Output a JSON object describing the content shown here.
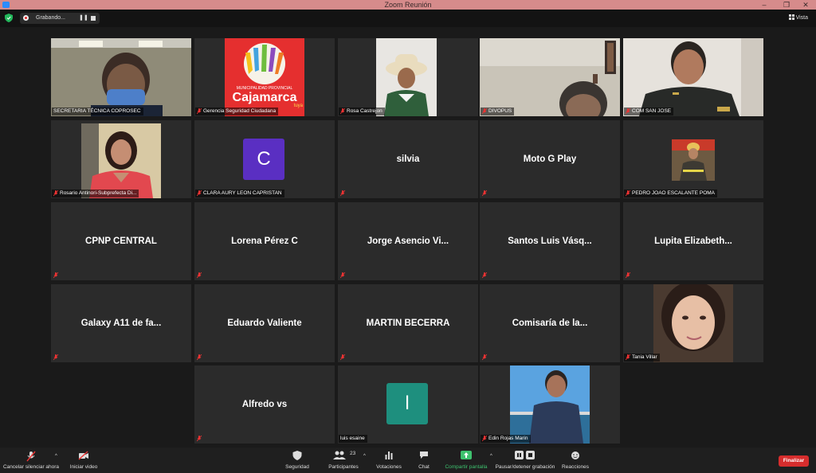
{
  "window": {
    "title": "Zoom Reunión",
    "minimize": "–",
    "maximize": "❐",
    "close": "✕"
  },
  "topbar": {
    "recording_label": "Grabando...",
    "pause_glyph": "❚❚",
    "view_label": "Vista"
  },
  "participants": [
    {
      "id": "secretaria",
      "label": "SECRETARIA TÉCNICA COPROSEC",
      "type": "video",
      "muted": false
    },
    {
      "id": "gerencia",
      "label": "Gerencia Seguridad Ciudadana",
      "type": "video",
      "muted": true,
      "logo_small": "MUNICIPALIDAD PROVINCIAL",
      "logo_big": "Cajamarca",
      "logo_tag": "tuya"
    },
    {
      "id": "rosa",
      "label": "Rosa Castrejon",
      "type": "video",
      "muted": true
    },
    {
      "id": "divopus",
      "label": "DIVOPUS",
      "type": "video",
      "muted": true,
      "active": true
    },
    {
      "id": "comsanjose",
      "label": "COM SAN JOSE",
      "type": "video",
      "muted": true
    },
    {
      "id": "rosario",
      "label": "Rosario Antinori-Subprefecta Di...",
      "type": "video",
      "muted": true
    },
    {
      "id": "clara",
      "label": "CLARA AURY LEON CAPRISTAN",
      "type": "avatar",
      "muted": true,
      "initial": "C",
      "color": "#5a2fc2"
    },
    {
      "id": "silvia",
      "name": "silvia",
      "type": "name",
      "muted": true
    },
    {
      "id": "motog",
      "name": "Moto G Play",
      "type": "name",
      "muted": true
    },
    {
      "id": "pedro",
      "label": "PEDRO JOAO ESCALANTE POMA",
      "type": "video",
      "muted": true
    },
    {
      "id": "cpnp",
      "name": "CPNP CENTRAL",
      "type": "name",
      "muted": true
    },
    {
      "id": "lorena",
      "name": "Lorena Pérez C",
      "type": "name",
      "muted": true
    },
    {
      "id": "jorge",
      "name": "Jorge Asencio Vi...",
      "type": "name",
      "muted": true
    },
    {
      "id": "santos",
      "name": "Santos Luis Vásq...",
      "type": "name",
      "muted": true
    },
    {
      "id": "lupita",
      "name": "Lupita Elizabeth...",
      "type": "name",
      "muted": true
    },
    {
      "id": "galaxy",
      "name": "Galaxy A11 de fa...",
      "type": "name",
      "muted": true
    },
    {
      "id": "eduardo",
      "name": "Eduardo Valiente",
      "type": "name",
      "muted": true
    },
    {
      "id": "martin",
      "name": "MARTIN BECERRA",
      "type": "name",
      "muted": true
    },
    {
      "id": "comisaria",
      "name": "Comisaría de la...",
      "type": "name",
      "muted": true
    },
    {
      "id": "tania",
      "label": "Tania Villar",
      "type": "video",
      "muted": true
    },
    {
      "id": "alfredo",
      "name": "Alfredo vs",
      "type": "name",
      "muted": true
    },
    {
      "id": "luis",
      "label": "luis esaine",
      "type": "avatar",
      "muted": false,
      "initial": "l",
      "color": "#1e8f7e"
    },
    {
      "id": "edin",
      "label": "Edin Rojas Marin",
      "type": "video",
      "muted": true
    }
  ],
  "toolbar": {
    "unmute": "Cancelar silenciar ahora",
    "start_video": "Iniciar video",
    "security": "Seguridad",
    "participants": "Participantes",
    "participants_count": "23",
    "polls": "Votaciones",
    "chat": "Chat",
    "share": "Compartir pantalla",
    "record": "Pausar/detener grabación",
    "reactions": "Reacciones",
    "end": "Finalizar"
  },
  "colors": {
    "active_border": "#c8e06a",
    "share_green": "#3ec16e",
    "end_red": "#d62d2d",
    "titlebar": "#d68b8b"
  }
}
